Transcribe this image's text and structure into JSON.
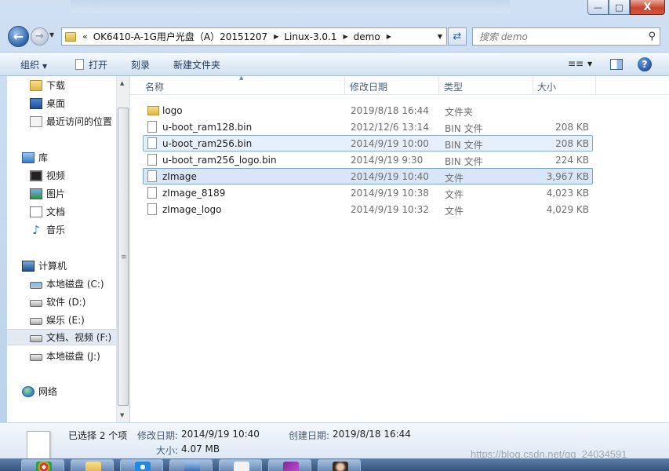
{
  "window": {
    "controls": {
      "minimize": "—",
      "maximize": "□",
      "close": "X"
    }
  },
  "address": {
    "chevron": "«",
    "crumbs": [
      "OK6410-A-1G用户光盘（A）20151207",
      "Linux-3.0.1",
      "demo"
    ]
  },
  "search": {
    "placeholder": "搜索 demo"
  },
  "toolbar": {
    "organize": "组织",
    "open": "打开",
    "burn": "刻录",
    "new_folder": "新建文件夹"
  },
  "nav": {
    "favorites": [
      "下载",
      "桌面",
      "最近访问的位置"
    ],
    "libraries_title": "库",
    "libraries": [
      "视频",
      "图片",
      "文档",
      "音乐"
    ],
    "computer_title": "计算机",
    "drives": [
      "本地磁盘 (C:)",
      "软件 (D:)",
      "娱乐 (E:)",
      "文档、视频 (F:)",
      "本地磁盘 (J:)"
    ],
    "network": "网络",
    "selected": "文档、视频 (F:)"
  },
  "columns": {
    "name": "名称",
    "date": "修改日期",
    "type": "类型",
    "size": "大小"
  },
  "files": [
    {
      "name": "logo",
      "date": "2019/8/18 16:44",
      "type": "文件夹",
      "size": "",
      "icon": "folder-icon"
    },
    {
      "name": "u-boot_ram128.bin",
      "date": "2012/12/6 13:14",
      "type": "BIN 文件",
      "size": "208 KB",
      "icon": "file-icon"
    },
    {
      "name": "u-boot_ram256.bin",
      "date": "2014/9/19 10:00",
      "type": "BIN 文件",
      "size": "208 KB",
      "icon": "file-icon"
    },
    {
      "name": "u-boot_ram256_logo.bin",
      "date": "2014/9/19 9:30",
      "type": "BIN 文件",
      "size": "224 KB",
      "icon": "file-icon"
    },
    {
      "name": "zImage",
      "date": "2014/9/19 10:40",
      "type": "文件",
      "size": "3,967 KB",
      "icon": "file-icon"
    },
    {
      "name": "zImage_8189",
      "date": "2014/9/19 10:38",
      "type": "文件",
      "size": "4,023 KB",
      "icon": "file-icon"
    },
    {
      "name": "zImage_logo",
      "date": "2014/9/19 10:32",
      "type": "文件",
      "size": "4,029 KB",
      "icon": "file-icon"
    }
  ],
  "selected_files": [
    "u-boot_ram256.bin",
    "zImage"
  ],
  "details": {
    "selection": "已选择 2 个项",
    "modified_label": "修改日期:",
    "modified_value": "2014/9/19 10:40",
    "created_label": "创建日期:",
    "created_value": "2019/8/18 16:44",
    "size_label": "大小:",
    "size_value": "4.07 MB"
  },
  "watermark": "https://blog.csdn.net/qq_24034591",
  "colors": {
    "selection": "#e7eff9",
    "selection_border": "#84acdd",
    "toolbar_text": "#1e395b"
  }
}
